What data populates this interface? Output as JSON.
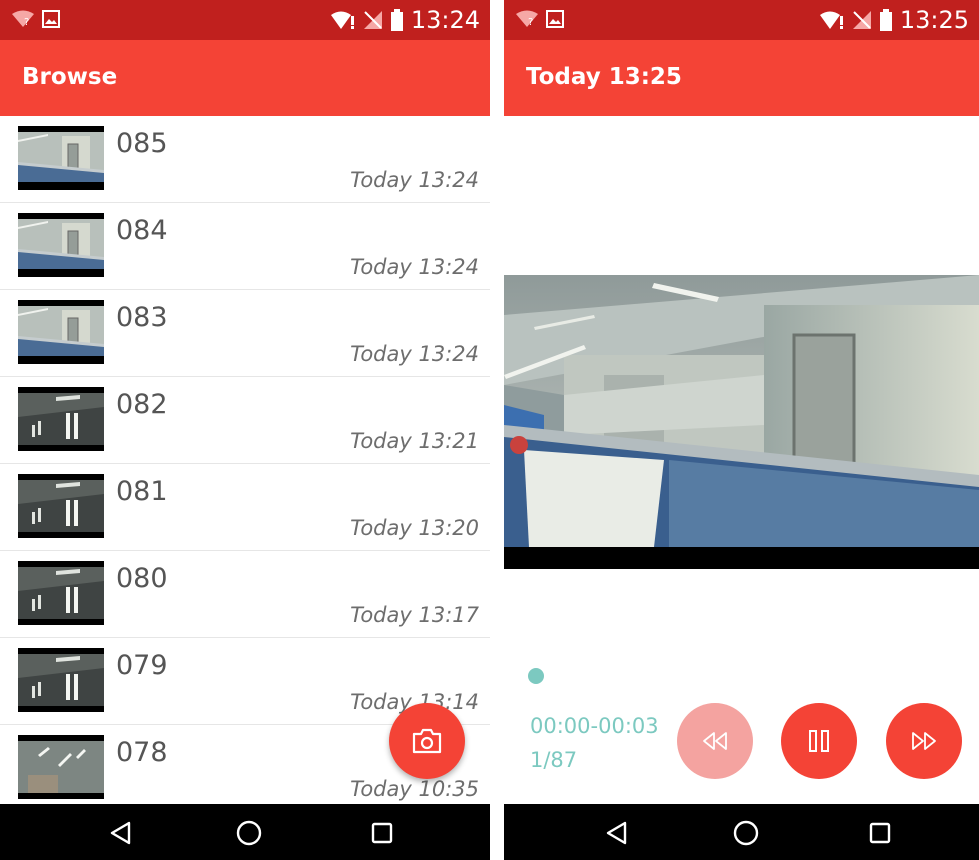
{
  "left": {
    "status": {
      "time": "13:24"
    },
    "appbar": {
      "title": "Browse"
    },
    "items": [
      {
        "name": "085",
        "time": "Today 13:24",
        "thumb": "office"
      },
      {
        "name": "084",
        "time": "Today 13:24",
        "thumb": "office"
      },
      {
        "name": "083",
        "time": "Today 13:24",
        "thumb": "office"
      },
      {
        "name": "082",
        "time": "Today 13:21",
        "thumb": "ceiling"
      },
      {
        "name": "081",
        "time": "Today 13:20",
        "thumb": "ceiling"
      },
      {
        "name": "080",
        "time": "Today 13:17",
        "thumb": "ceiling"
      },
      {
        "name": "079",
        "time": "Today 13:14",
        "thumb": "ceiling"
      },
      {
        "name": "078",
        "time": "Today 10:35",
        "thumb": "ceiling-light"
      }
    ],
    "fab": {
      "icon": "camera-icon"
    }
  },
  "right": {
    "status": {
      "time": "13:25"
    },
    "appbar": {
      "title": "Today 13:25"
    },
    "player": {
      "time_range": "00:00-00:03",
      "frame_counter": "1/87",
      "progress": 0.0
    }
  },
  "colors": {
    "status_bar": "#c0201e",
    "app_bar": "#f44336",
    "accent_teal": "#7cc9c0",
    "button_disabled": "#f4a3a0"
  }
}
